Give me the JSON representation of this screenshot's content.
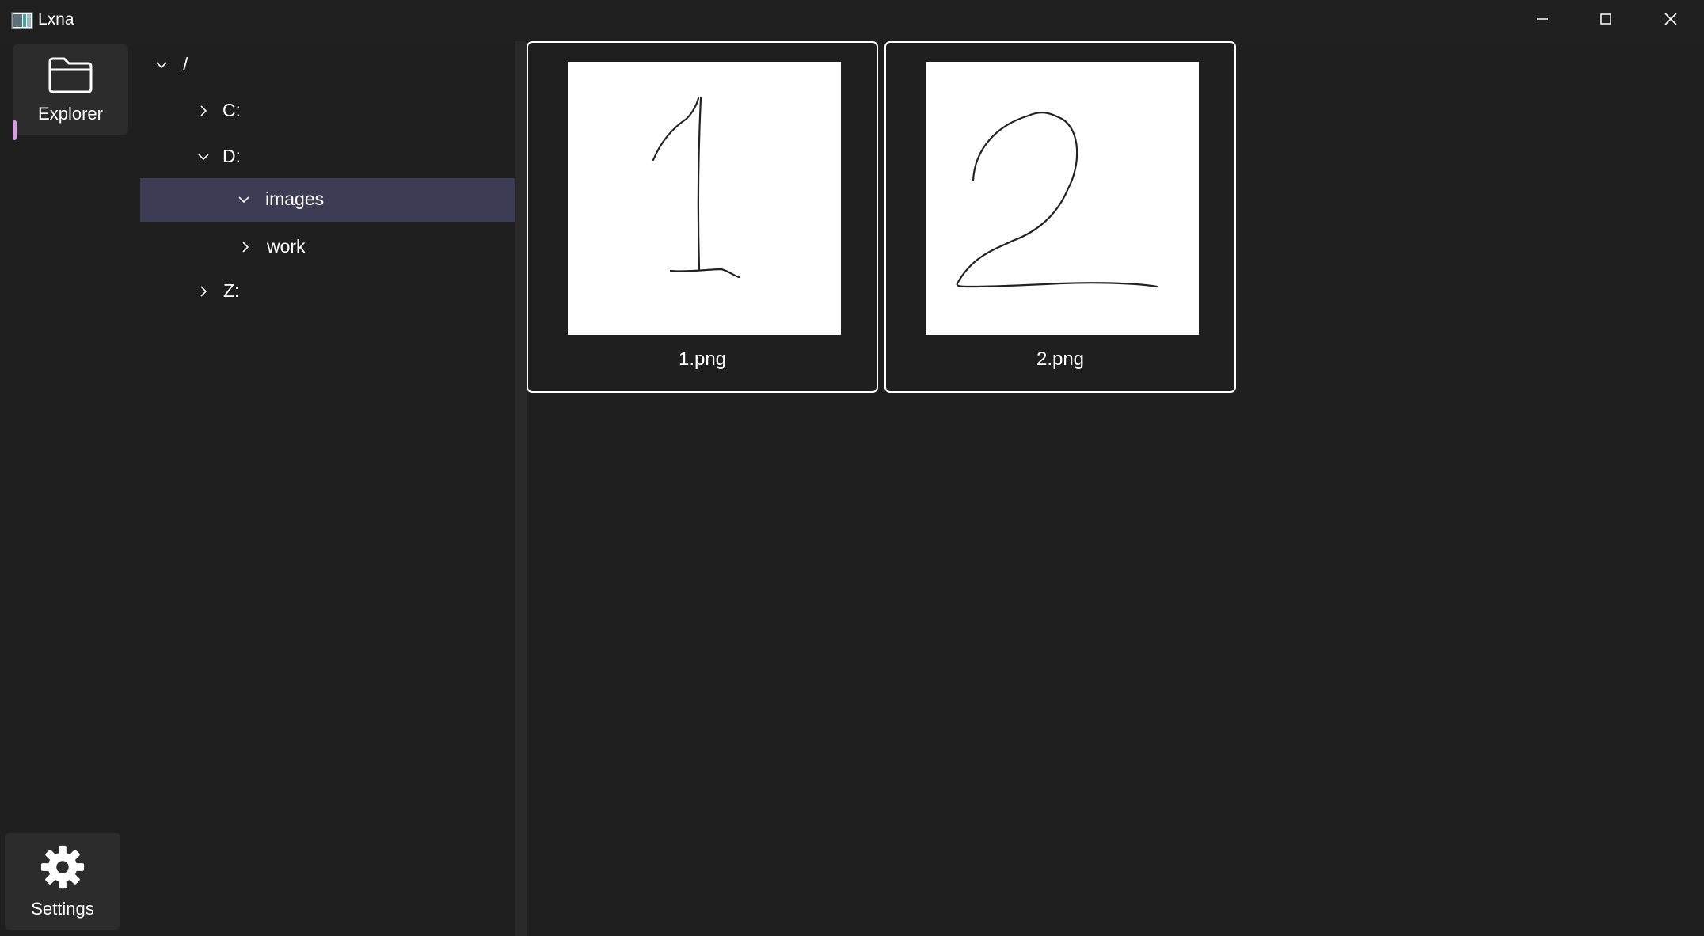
{
  "window": {
    "title": "Lxna",
    "controls": [
      "minimize-icon",
      "maximize-icon",
      "close-icon"
    ]
  },
  "nav": {
    "explorer": {
      "label": "Explorer",
      "icon": "folder-icon",
      "active": true
    },
    "settings": {
      "label": "Settings",
      "icon": "gear-icon"
    }
  },
  "tree": {
    "items": [
      {
        "label": "/",
        "expanded": true,
        "level": 0
      },
      {
        "label": "C:",
        "expanded": false,
        "level": 1
      },
      {
        "label": "D:",
        "expanded": true,
        "level": 1
      },
      {
        "label": "images",
        "expanded": true,
        "level": 2,
        "selected": true
      },
      {
        "label": "work",
        "expanded": false,
        "level": 2
      },
      {
        "label": "Z:",
        "expanded": false,
        "level": 1
      }
    ]
  },
  "files": [
    {
      "name": "1.png",
      "preview": "handwritten digit 1"
    },
    {
      "name": "2.png",
      "preview": "handwritten digit 2"
    }
  ],
  "colors": {
    "background": "#1f1f1f",
    "selection": "#3c3c54",
    "accent": "#d79be2",
    "text": "#ffffff"
  }
}
